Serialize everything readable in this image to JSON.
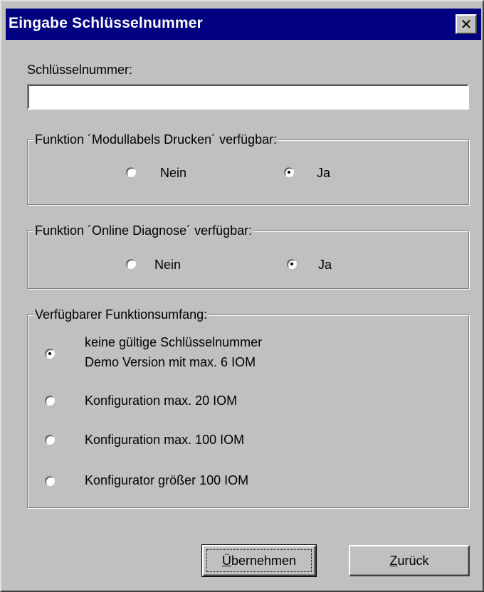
{
  "window": {
    "title": "Eingabe Schlüsselnummer",
    "close_glyph": "✕"
  },
  "key_field": {
    "label": "Schlüsselnummer:",
    "value": ""
  },
  "group_modullabels": {
    "legend": "Funktion ´Modullabels Drucken´ verfügbar:",
    "options": [
      {
        "label": "Nein",
        "checked": false
      },
      {
        "label": "Ja",
        "checked": true
      }
    ]
  },
  "group_online": {
    "legend": "Funktion ´Online Diagnose´ verfügbar:",
    "options": [
      {
        "label": "Nein",
        "checked": false
      },
      {
        "label": "Ja",
        "checked": true
      }
    ]
  },
  "group_umfang": {
    "legend": "Verfügbarer Funktionsumfang:",
    "options": [
      {
        "line1": "keine gültige Schlüsselnummer",
        "line2": "Demo Version mit max. 6 IOM",
        "checked": true
      },
      {
        "line1": "Konfiguration max. 20 IOM",
        "checked": false
      },
      {
        "line1": "Konfiguration max. 100 IOM",
        "checked": false
      },
      {
        "line1": "Konfigurator größer 100 IOM",
        "checked": false
      }
    ]
  },
  "buttons": {
    "apply": {
      "mnemonic": "Ü",
      "rest": "bernehmen"
    },
    "back": {
      "mnemonic": "Z",
      "rest": "urück"
    }
  },
  "colors": {
    "titlebar": "#000080",
    "face": "#c0c0c0"
  },
  "icons": {
    "close": "close-icon"
  }
}
